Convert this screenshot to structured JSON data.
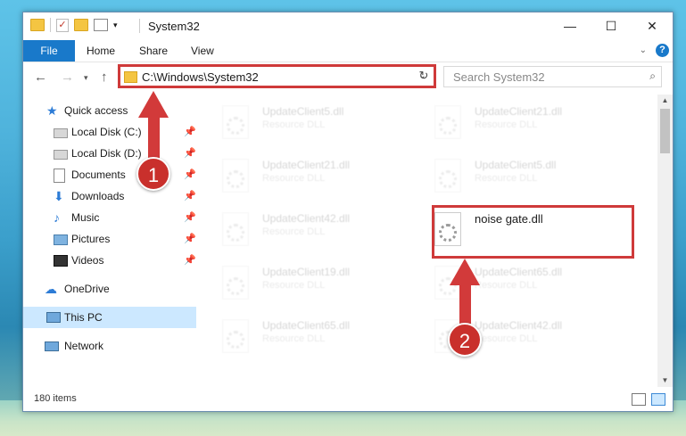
{
  "window": {
    "title": "System32",
    "controls": {
      "minimize": "—",
      "maximize": "☐",
      "close": "✕"
    }
  },
  "ribbon": {
    "tabs": [
      "File",
      "Home",
      "Share",
      "View"
    ],
    "help": "?"
  },
  "address": {
    "path": "C:\\Windows\\System32",
    "search_placeholder": "Search System32"
  },
  "nav": {
    "items": [
      {
        "label": "Quick access",
        "icon": "star-icon"
      },
      {
        "label": "Local Disk (C:)",
        "icon": "drive-icon"
      },
      {
        "label": "Local Disk (D:)",
        "icon": "drive-icon"
      },
      {
        "label": "Documents",
        "icon": "documents-icon"
      },
      {
        "label": "Downloads",
        "icon": "downloads-icon"
      },
      {
        "label": "Music",
        "icon": "music-icon"
      },
      {
        "label": "Pictures",
        "icon": "pictures-icon"
      },
      {
        "label": "Videos",
        "icon": "videos-icon"
      },
      {
        "label": "OneDrive",
        "icon": "cloud-icon"
      },
      {
        "label": "This PC",
        "icon": "computer-icon"
      },
      {
        "label": "Network",
        "icon": "network-icon"
      }
    ]
  },
  "files": [
    {
      "name": "UpdateClient5.dll",
      "type": "Resource DLL"
    },
    {
      "name": "UpdateClient21.dll",
      "type": "Resource DLL"
    },
    {
      "name": "UpdateClient21.dll",
      "type": "Resource DLL"
    },
    {
      "name": "UpdateClient5.dll",
      "type": "Resource DLL"
    },
    {
      "name": "UpdateClient42.dll",
      "type": "Resource DLL"
    },
    {
      "name": "noise gate.dll",
      "type": ""
    },
    {
      "name": "UpdateClient19.dll",
      "type": "Resource DLL"
    },
    {
      "name": "UpdateClient65.dll",
      "type": "Resource DLL"
    },
    {
      "name": "UpdateClient65.dll",
      "type": "Resource DLL"
    },
    {
      "name": "UpdateClient42.dll",
      "type": "Resource DLL"
    }
  ],
  "status": {
    "item_count": "180 items"
  },
  "callouts": [
    "1",
    "2"
  ],
  "colors": {
    "accent": "#1979ca",
    "highlight": "#cf3a3a",
    "selection": "#cce8ff"
  }
}
